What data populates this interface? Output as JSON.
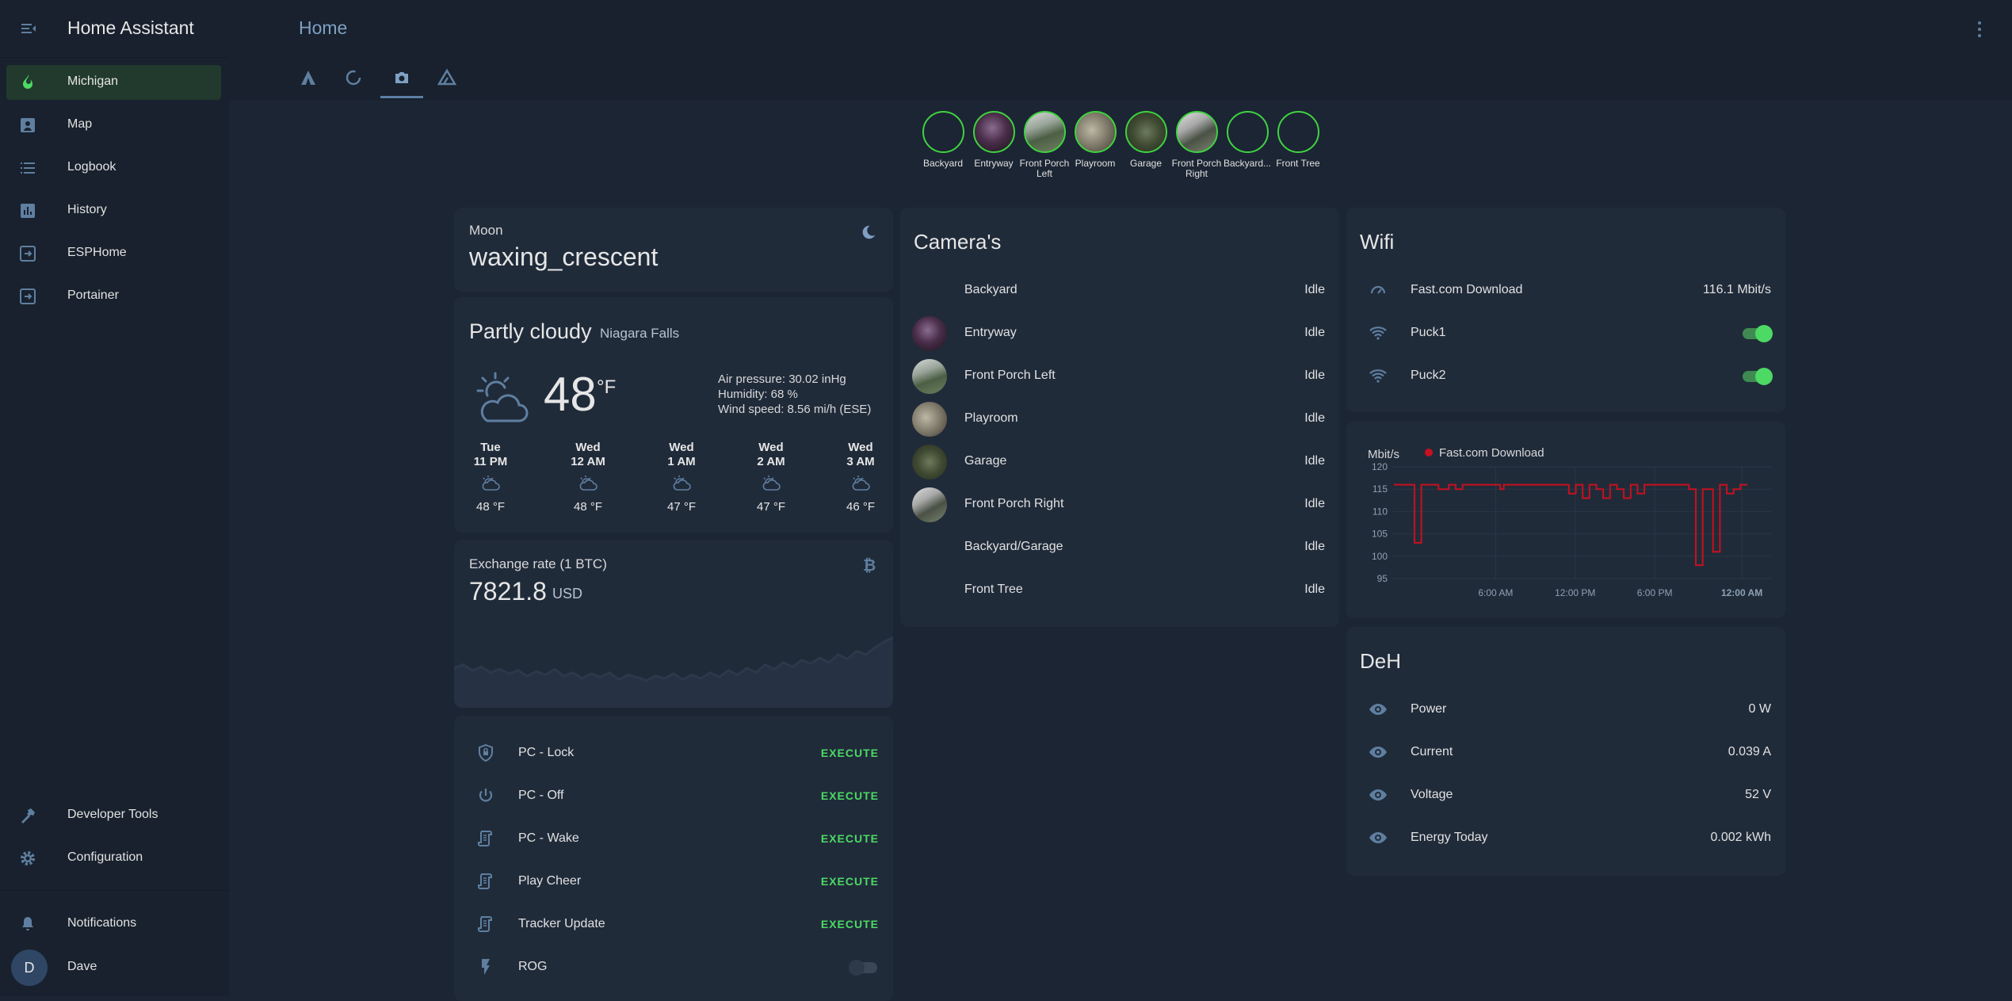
{
  "app": {
    "title": "Home Assistant"
  },
  "sidebar": {
    "items": [
      {
        "label": "Michigan",
        "icon": "fire-icon",
        "active": true
      },
      {
        "label": "Map",
        "icon": "map-icon"
      },
      {
        "label": "Logbook",
        "icon": "list-icon"
      },
      {
        "label": "History",
        "icon": "chart-icon"
      },
      {
        "label": "ESPHome",
        "icon": "login-icon"
      },
      {
        "label": "Portainer",
        "icon": "login-icon"
      }
    ],
    "bottom": [
      {
        "label": "Developer Tools",
        "icon": "hammer-icon"
      },
      {
        "label": "Configuration",
        "icon": "gear-icon"
      },
      {
        "label": "Notifications",
        "icon": "bell-icon"
      }
    ],
    "user": {
      "initial": "D",
      "name": "Dave"
    }
  },
  "header": {
    "title": "Home",
    "tabs": [
      {
        "icon": "delta-icon"
      },
      {
        "icon": "loading-icon"
      },
      {
        "icon": "camera-icon",
        "active": true
      },
      {
        "icon": "triangle-outline-icon"
      }
    ]
  },
  "camera_strip": [
    {
      "name": "Backyard",
      "image": false
    },
    {
      "name": "Entryway",
      "image": true
    },
    {
      "name": "Front Porch Left",
      "image": true
    },
    {
      "name": "Playroom",
      "image": true
    },
    {
      "name": "Garage",
      "image": true
    },
    {
      "name": "Front Porch Right",
      "image": true
    },
    {
      "name": "Backyard...",
      "image": false
    },
    {
      "name": "Front Tree",
      "image": false
    }
  ],
  "moon": {
    "label": "Moon",
    "value": "waxing_crescent",
    "icon": "moon-icon"
  },
  "weather": {
    "condition": "Partly cloudy",
    "location": "Niagara Falls",
    "temperature": "48",
    "unit": "°F",
    "air_pressure": "Air pressure: 30.02 inHg",
    "humidity": "Humidity: 68 %",
    "wind": "Wind speed: 8.56 mi/h (ESE)",
    "forecast": [
      {
        "day": "Tue",
        "time": "11 PM",
        "temp": "48 °F"
      },
      {
        "day": "Wed",
        "time": "12 AM",
        "temp": "48 °F"
      },
      {
        "day": "Wed",
        "time": "1 AM",
        "temp": "47 °F"
      },
      {
        "day": "Wed",
        "time": "2 AM",
        "temp": "47 °F"
      },
      {
        "day": "Wed",
        "time": "3 AM",
        "temp": "46 °F"
      }
    ]
  },
  "exchange": {
    "label": "Exchange rate (1 BTC)",
    "value": "7821.8",
    "unit": "USD",
    "icon": "bitcoin-icon",
    "sparkline": [
      35,
      38,
      33,
      36,
      31,
      34,
      30,
      33,
      28,
      32,
      29,
      34,
      28,
      31,
      26,
      30,
      27,
      31,
      25,
      29,
      27,
      24,
      28,
      26,
      30,
      25,
      29,
      26,
      31,
      27,
      33,
      29,
      35,
      31,
      38,
      34,
      40,
      36,
      42,
      39,
      44,
      40,
      47,
      43,
      50,
      47,
      53,
      58,
      62
    ]
  },
  "scripts": {
    "execute_label": "EXECUTE",
    "items": [
      {
        "label": "PC - Lock",
        "icon": "shield-lock-icon",
        "action": "execute"
      },
      {
        "label": "PC - Off",
        "icon": "power-icon",
        "action": "execute"
      },
      {
        "label": "PC - Wake",
        "icon": "script-icon",
        "action": "execute"
      },
      {
        "label": "Play Cheer",
        "icon": "script-icon",
        "action": "execute"
      },
      {
        "label": "Tracker Update",
        "icon": "script-icon",
        "action": "execute"
      },
      {
        "label": "ROG",
        "icon": "flash-icon",
        "action": "toggle",
        "state": "off"
      }
    ]
  },
  "cameras": {
    "title": "Camera's",
    "items": [
      {
        "name": "Backyard",
        "state": "Idle",
        "image": false
      },
      {
        "name": "Entryway",
        "state": "Idle",
        "image": true
      },
      {
        "name": "Front Porch Left",
        "state": "Idle",
        "image": true
      },
      {
        "name": "Playroom",
        "state": "Idle",
        "image": true
      },
      {
        "name": "Garage",
        "state": "Idle",
        "image": true
      },
      {
        "name": "Front Porch Right",
        "state": "Idle",
        "image": true
      },
      {
        "name": "Backyard/Garage",
        "state": "Idle",
        "image": false
      },
      {
        "name": "Front Tree",
        "state": "Idle",
        "image": false
      }
    ]
  },
  "wifi": {
    "title": "Wifi",
    "items": [
      {
        "name": "Fast.com Download",
        "value": "116.1 Mbit/s",
        "icon": "speedometer-icon"
      },
      {
        "name": "Puck1",
        "toggle": "on",
        "icon": "wifi-icon"
      },
      {
        "name": "Puck2",
        "toggle": "on",
        "icon": "wifi-icon"
      }
    ]
  },
  "chart_data": {
    "type": "line",
    "ylabel": "Mbit/s",
    "series": [
      {
        "name": "Fast.com Download",
        "color": "#c8101e",
        "values": [
          116,
          116,
          116,
          116,
          116,
          116,
          103,
          103,
          116,
          116,
          116,
          116,
          116,
          115,
          115,
          115,
          116,
          116,
          115,
          115,
          116,
          116,
          116,
          116,
          116,
          116,
          116,
          116,
          116,
          116,
          116,
          115,
          116,
          116,
          116,
          116,
          116,
          116,
          116,
          116,
          116,
          116,
          116,
          116,
          116,
          116,
          116,
          116,
          116,
          116,
          116,
          114,
          114,
          116,
          116,
          113,
          113,
          116,
          116,
          115,
          115,
          113,
          113,
          116,
          116,
          115,
          115,
          113,
          113,
          116,
          116,
          114,
          114,
          116,
          116,
          116,
          116,
          116,
          116,
          116,
          116,
          116,
          116,
          116,
          116,
          116,
          115,
          115,
          98,
          98,
          115,
          115,
          115,
          101,
          101,
          116,
          116,
          114,
          114,
          115,
          115,
          116,
          116
        ]
      }
    ],
    "ylim": [
      95,
      120
    ],
    "yticks": [
      95,
      100,
      105,
      110,
      115,
      120
    ],
    "xtick_labels": [
      "6:00 AM",
      "12:00 PM",
      "6:00 PM",
      "12:00 AM"
    ],
    "legend": "top-left",
    "grid": true
  },
  "deh": {
    "title": "DeH",
    "items": [
      {
        "name": "Power",
        "value": "0 W",
        "icon": "eye-icon"
      },
      {
        "name": "Current",
        "value": "0.039 A",
        "icon": "eye-icon"
      },
      {
        "name": "Voltage",
        "value": "52 V",
        "icon": "eye-icon"
      },
      {
        "name": "Energy Today",
        "value": "0.002 kWh",
        "icon": "eye-icon"
      }
    ]
  },
  "colors": {
    "background": "#1c2533",
    "card": "#202b3a",
    "sidebar": "#18212d",
    "accent_green": "#4cd964",
    "camera_ring": "#3fd340",
    "icon": "#5f7fa0",
    "chart_line": "#c8101e"
  }
}
